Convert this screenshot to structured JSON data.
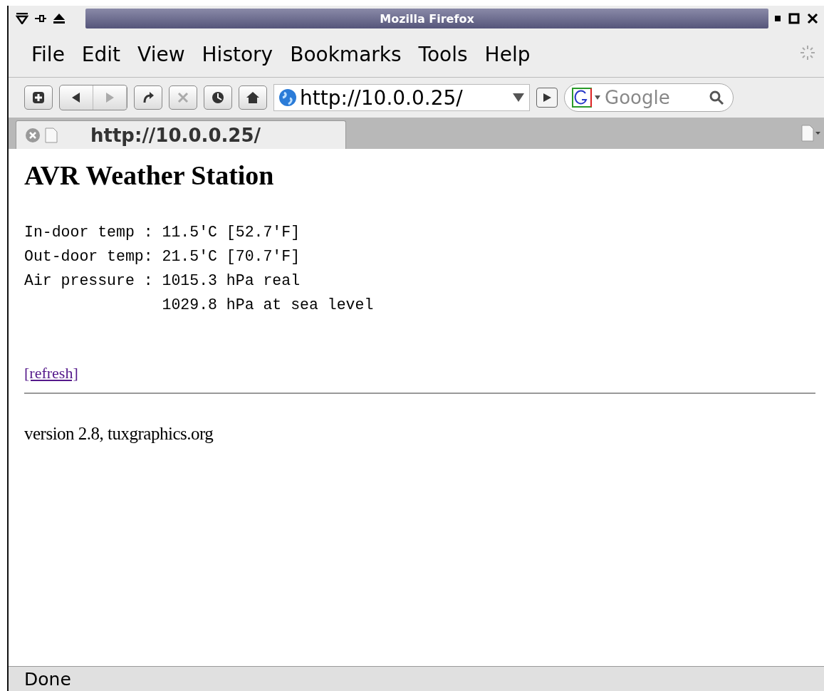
{
  "window": {
    "title": "Mozilla Firefox"
  },
  "menu": [
    "File",
    "Edit",
    "View",
    "History",
    "Bookmarks",
    "Tools",
    "Help"
  ],
  "toolbar": {
    "url": "http://10.0.0.25/",
    "search": {
      "placeholder": "Google"
    }
  },
  "tabs": [
    {
      "label": "http://10.0.0.25/",
      "selected": true
    }
  ],
  "page": {
    "heading": "AVR Weather Station",
    "readings": [
      "In-door temp : 11.5'C [52.7'F]",
      "Out-door temp: 21.5'C [70.7'F]",
      "Air pressure : 1015.3 hPa real",
      "               1029.8 hPa at sea level"
    ],
    "link": "[refresh]",
    "footer": "version 2.8, tuxgraphics.org"
  },
  "status_bar": "Done"
}
